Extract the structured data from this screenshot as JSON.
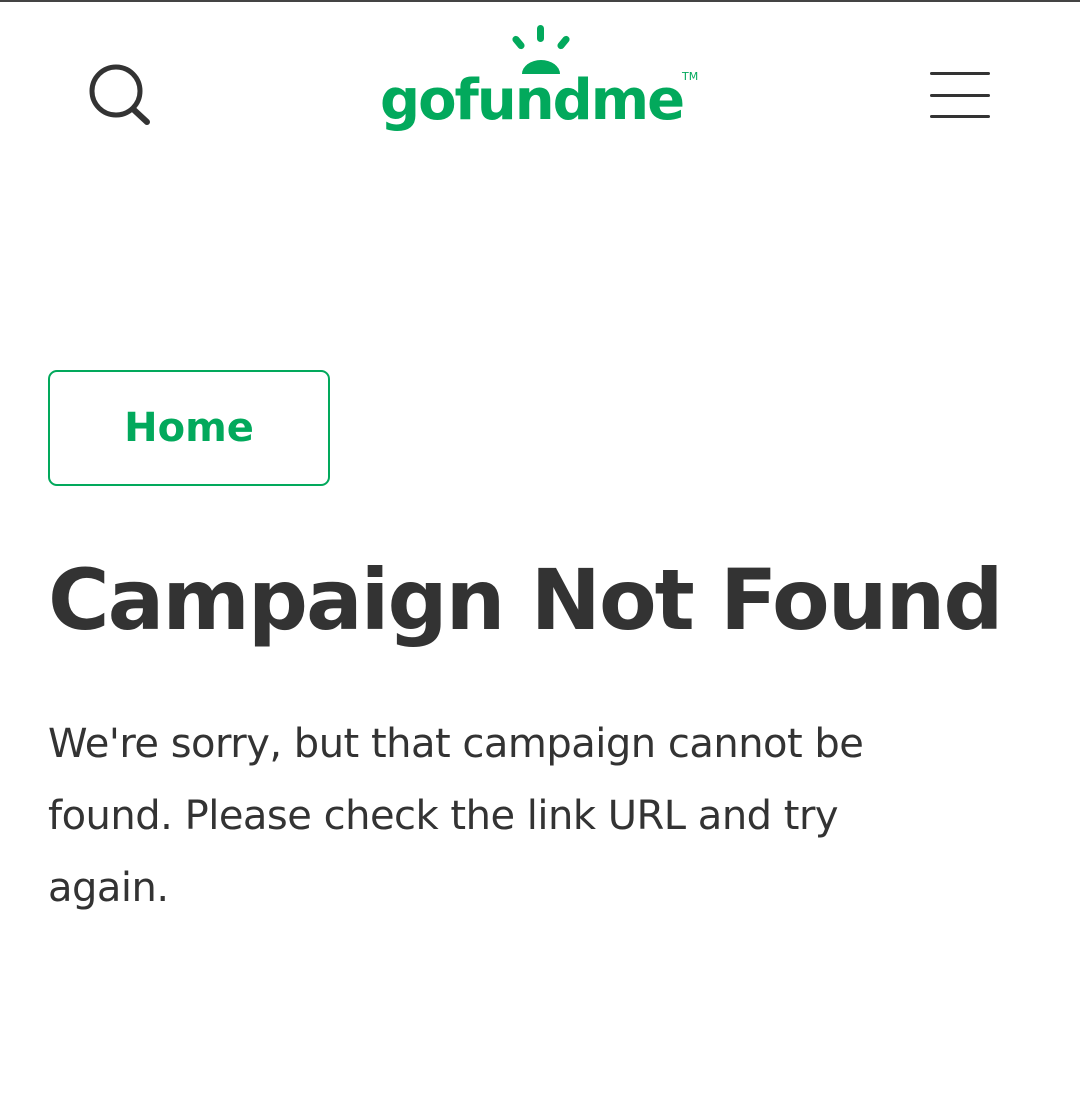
{
  "header": {
    "logo": {
      "wordmark": "gofundme",
      "trademark": "TM"
    },
    "search_icon": "search-icon",
    "menu_icon": "hamburger-menu-icon"
  },
  "main": {
    "home_button_label": "Home",
    "title": "Campaign Not Found",
    "message": "We're sorry, but that campaign cannot be found. Please check the link URL and try again."
  },
  "colors": {
    "brand_green": "#02a95c",
    "text_dark": "#333333",
    "background": "#ffffff"
  }
}
